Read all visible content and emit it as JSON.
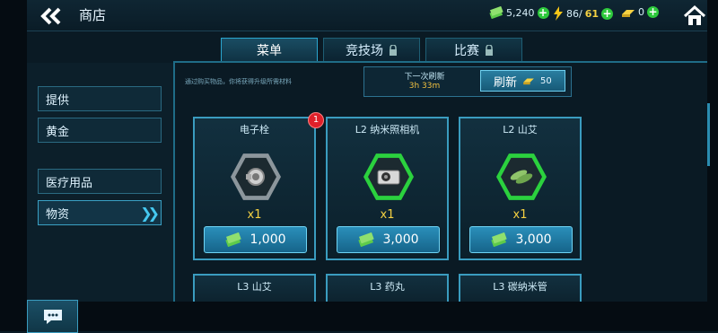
{
  "header": {
    "title": "商店",
    "resources": [
      {
        "value": "5,240",
        "icon": "cash-icon"
      },
      {
        "value": "86/",
        "value_cap": "61",
        "icon": "energy-icon"
      },
      {
        "value": "0",
        "icon": "gold-icon"
      }
    ]
  },
  "tabs": [
    {
      "label": "菜单",
      "locked": false
    },
    {
      "label": "竞技场",
      "locked": true
    },
    {
      "label": "比赛",
      "locked": true
    }
  ],
  "sidebar": {
    "items": [
      {
        "label": "提供"
      },
      {
        "label": "黄金"
      },
      {
        "label": "医疗用品"
      },
      {
        "label": "物资",
        "selected": true
      }
    ]
  },
  "notice": "通过购买物品，你将获得升级所需材料",
  "refresh": {
    "label": "下一次刷新",
    "timer": "3h 33m",
    "button_label": "刷新",
    "cost": "50"
  },
  "items": [
    {
      "name": "电子栓",
      "quantity": "x1",
      "price": "1,000",
      "badge": "1"
    },
    {
      "name": "L2 纳米照相机",
      "quantity": "x1",
      "price": "3,000"
    },
    {
      "name": "L2 山艾",
      "quantity": "x1",
      "price": "3,000"
    }
  ],
  "items_row2": [
    {
      "name": "L3 山艾"
    },
    {
      "name": "L3 药丸"
    },
    {
      "name": "L3 碳纳米管"
    }
  ],
  "colors": {
    "accent": "#3a9cbf",
    "gold": "#f5d142",
    "plus_green": "#2dc93c",
    "badge_red": "#e0202a"
  }
}
